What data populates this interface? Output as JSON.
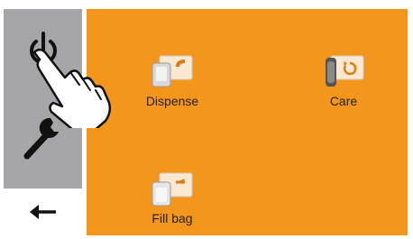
{
  "sidebar": {
    "items": [
      {
        "icon": "power-icon"
      },
      {
        "icon": "wrench-icon"
      }
    ],
    "back": {
      "icon": "arrow-left-icon"
    }
  },
  "main": {
    "tiles": [
      {
        "label": "Dispense",
        "icon": "dispense-icon"
      },
      {
        "label": "Care",
        "icon": "care-icon"
      },
      {
        "label": "Fill bag",
        "icon": "fill-bag-icon"
      }
    ]
  },
  "colors": {
    "accent": "#f4961b",
    "sidebar": "#a6a6a8"
  }
}
